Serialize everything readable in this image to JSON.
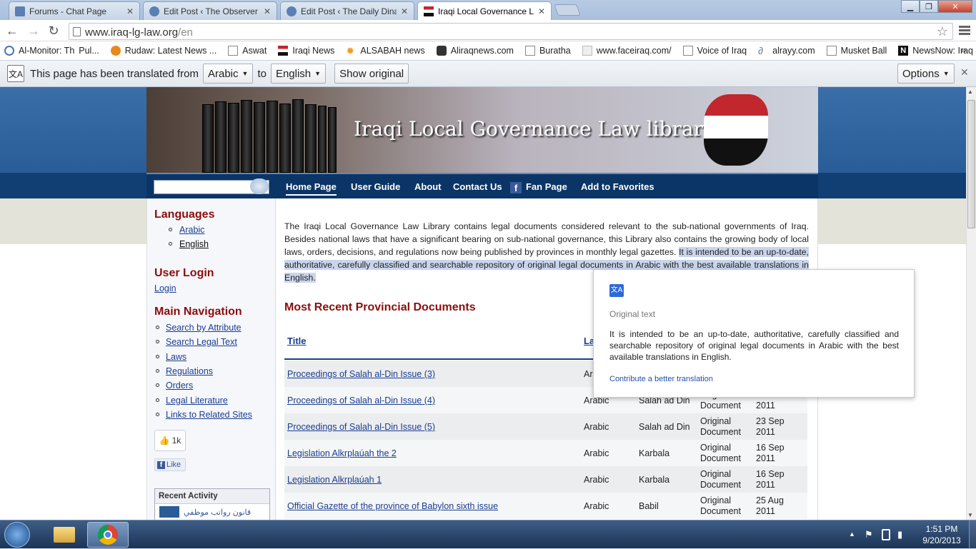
{
  "browser": {
    "tabs": [
      {
        "title": "Forums - Chat Page",
        "active": false
      },
      {
        "title": "Edit Post ‹ The Observer — WordPress",
        "active": false
      },
      {
        "title": "Edit Post ‹ The Daily Dinar — WordPress",
        "active": false
      },
      {
        "title": "Iraqi Local Governance Law Library",
        "active": true
      }
    ],
    "window_controls": {
      "minimize": "▁",
      "maximize": "❐",
      "close": "✕"
    },
    "url_host": "www.iraq-lg-law.org",
    "url_path": "/en",
    "bookmarks": [
      "Al-Monitor: Th",
      "Pul...",
      "Rudaw: Latest News ...",
      "Aswat",
      "Iraqi News",
      "ALSABAH news",
      "Aliraqnews.com",
      "Buratha",
      "www.faceiraq.com/",
      "Voice of Iraq",
      "alrayy.com",
      "Musket Ball",
      "NewsNow: Iraq New..."
    ],
    "bookmarks_overflow": "»"
  },
  "translate_bar": {
    "prefix": "This page has been translated from",
    "from_lang": "Arabic",
    "to_word": "to",
    "to_lang": "English",
    "show_original": "Show original",
    "options": "Options"
  },
  "site": {
    "banner_title": "Iraqi Local Governance Law library",
    "nav": {
      "home": "Home Page",
      "guide": "User Guide",
      "about": "About",
      "contact": "Contact Us",
      "fan": "Fan Page",
      "favorites": "Add to Favorites"
    },
    "sidebar": {
      "languages_heading": "Languages",
      "languages": [
        "Arabic",
        "English"
      ],
      "login_heading": "User Login",
      "login_link": "Login",
      "main_nav_heading": "Main Navigation",
      "main_nav": [
        "Search by Attribute",
        "Search Legal Text",
        "Laws",
        "Regulations",
        "Orders",
        "Legal Literature",
        "Links to Related Sites"
      ],
      "like_count": "1k",
      "like_label": "Like",
      "recent_activity": "Recent Activity",
      "recent_item": "قانون رواتب موظفي"
    },
    "intro_plain": "The Iraqi Local Governance Law Library contains legal documents considered relevant to the sub-national governments of Iraq. Besides national laws that have a significant bearing on sub-national governance, this Library also contains the growing body of local laws, orders, decisions, and regulations now being published by provinces in monthly legal gazettes.",
    "intro_highlight": "It is intended to be an up-to-date, authoritative, carefully classified and searchable repository of original legal documents in Arabic with the best available translations in English.",
    "recent_heading": "Most Recent Provincial Documents",
    "table": {
      "header_title": "Title",
      "header_lang": "La",
      "rows": [
        {
          "title": "Proceedings of Salah al-Din Issue (3)",
          "lang": "Ar",
          "region": "",
          "type": [
            "",
            ""
          ],
          "date": [
            "",
            ""
          ]
        },
        {
          "title": "Proceedings of Salah al-Din Issue (4)",
          "lang": "Arabic",
          "region": "Salah ad Din",
          "type": [
            "Original",
            "Document"
          ],
          "date": [
            "",
            "2011"
          ]
        },
        {
          "title": "Proceedings of Salah al-Din Issue (5)",
          "lang": "Arabic",
          "region": "Salah ad Din",
          "type": [
            "Original",
            "Document"
          ],
          "date": [
            "23 Sep",
            "2011"
          ]
        },
        {
          "title": "Legislation Alkrplaúah the 2",
          "lang": "Arabic",
          "region": "Karbala",
          "type": [
            "Original",
            "Document"
          ],
          "date": [
            "16 Sep",
            "2011"
          ]
        },
        {
          "title": "Legislation Alkrplaúah 1",
          "lang": "Arabic",
          "region": "Karbala",
          "type": [
            "Original",
            "Document"
          ],
          "date": [
            "16 Sep",
            "2011"
          ]
        },
        {
          "title": "Official Gazette of the province of Babylon sixth issue",
          "lang": "Arabic",
          "region": "Babil",
          "type": [
            "Original",
            "Document"
          ],
          "date": [
            "25 Aug",
            "2011"
          ]
        }
      ]
    }
  },
  "tooltip": {
    "heading": "Original text",
    "body": "It is intended to be an up-to-date, authoritative, carefully classified and searchable repository of original legal documents in Arabic with the best available translations in English.",
    "contribute": "Contribute a better translation"
  },
  "taskbar": {
    "time": "1:51 PM",
    "date": "9/20/2013"
  },
  "colors": {
    "heading_red": "#8b0e0e",
    "link_blue": "#1a3d8f",
    "nav_bg": "#0b3566",
    "highlight": "#c9d5ec"
  }
}
